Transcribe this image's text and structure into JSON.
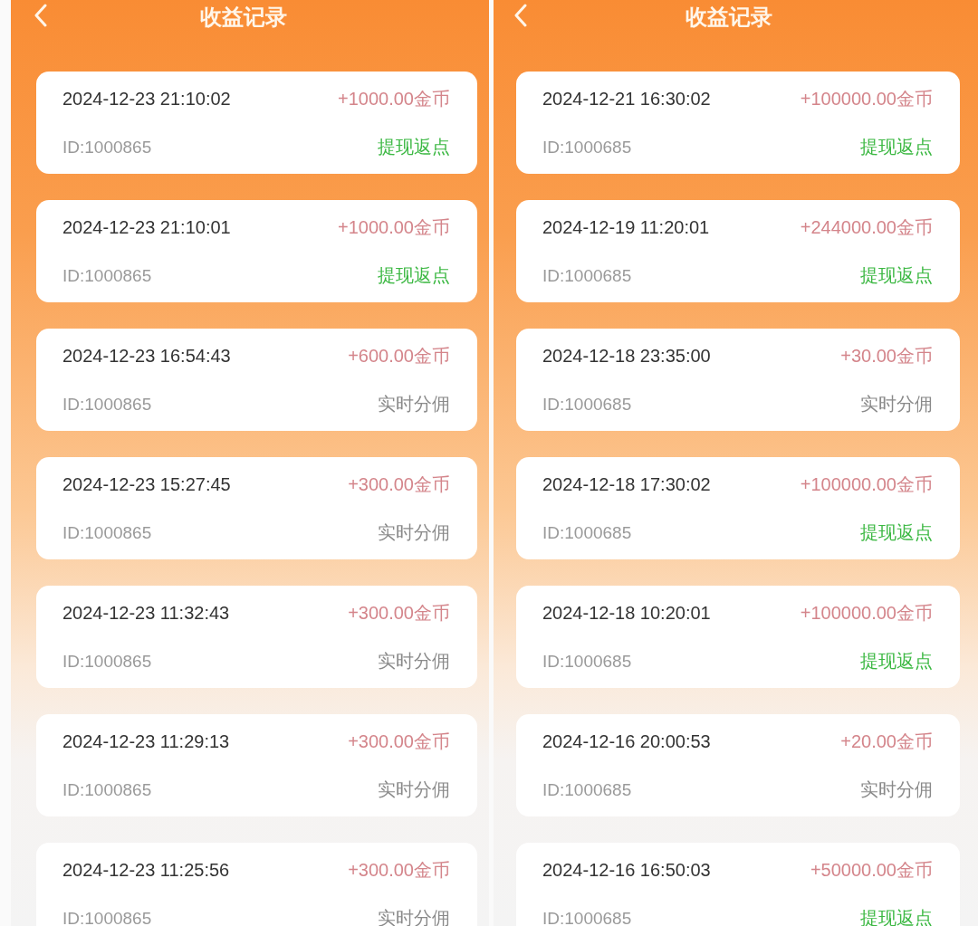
{
  "panels": [
    {
      "title": "收益记录",
      "records": [
        {
          "time": "2024-12-23 21:10:02",
          "amount": "+1000.00金币",
          "id": "ID:1000865",
          "type": "提现返点",
          "kind": "withdraw"
        },
        {
          "time": "2024-12-23 21:10:01",
          "amount": "+1000.00金币",
          "id": "ID:1000865",
          "type": "提现返点",
          "kind": "withdraw"
        },
        {
          "time": "2024-12-23 16:54:43",
          "amount": "+600.00金币",
          "id": "ID:1000865",
          "type": "实时分佣",
          "kind": "commission"
        },
        {
          "time": "2024-12-23 15:27:45",
          "amount": "+300.00金币",
          "id": "ID:1000865",
          "type": "实时分佣",
          "kind": "commission"
        },
        {
          "time": "2024-12-23 11:32:43",
          "amount": "+300.00金币",
          "id": "ID:1000865",
          "type": "实时分佣",
          "kind": "commission"
        },
        {
          "time": "2024-12-23 11:29:13",
          "amount": "+300.00金币",
          "id": "ID:1000865",
          "type": "实时分佣",
          "kind": "commission"
        },
        {
          "time": "2024-12-23 11:25:56",
          "amount": "+300.00金币",
          "id": "ID:1000865",
          "type": "实时分佣",
          "kind": "commission"
        }
      ]
    },
    {
      "title": "收益记录",
      "records": [
        {
          "time": "2024-12-21 16:30:02",
          "amount": "+100000.00金币",
          "id": "ID:1000685",
          "type": "提现返点",
          "kind": "withdraw"
        },
        {
          "time": "2024-12-19 11:20:01",
          "amount": "+244000.00金币",
          "id": "ID:1000685",
          "type": "提现返点",
          "kind": "withdraw"
        },
        {
          "time": "2024-12-18 23:35:00",
          "amount": "+30.00金币",
          "id": "ID:1000685",
          "type": "实时分佣",
          "kind": "commission"
        },
        {
          "time": "2024-12-18 17:30:02",
          "amount": "+100000.00金币",
          "id": "ID:1000685",
          "type": "提现返点",
          "kind": "withdraw"
        },
        {
          "time": "2024-12-18 10:20:01",
          "amount": "+100000.00金币",
          "id": "ID:1000685",
          "type": "提现返点",
          "kind": "withdraw"
        },
        {
          "time": "2024-12-16 20:00:53",
          "amount": "+20.00金币",
          "id": "ID:1000685",
          "type": "实时分佣",
          "kind": "commission"
        },
        {
          "time": "2024-12-16 16:50:03",
          "amount": "+50000.00金币",
          "id": "ID:1000685",
          "type": "提现返点",
          "kind": "withdraw"
        }
      ]
    }
  ]
}
